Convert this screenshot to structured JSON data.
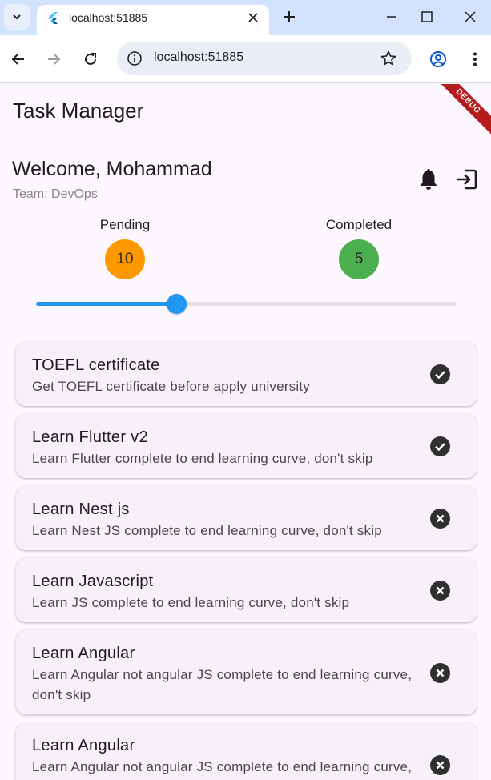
{
  "browser": {
    "tab_title": "localhost:51885",
    "url": "localhost:51885"
  },
  "app": {
    "title": "Task Manager",
    "debug_label": "DEBUG",
    "welcome": "Welcome, Mohammad",
    "team": "Team: DevOps",
    "stats": {
      "pending_label": "Pending",
      "pending_value": "10",
      "pending_color": "#ff9800",
      "completed_label": "Completed",
      "completed_value": "5",
      "completed_color": "#4caf50"
    },
    "progress_slider": {
      "fraction": 0.333
    },
    "tasks": [
      {
        "title": "TOEFL certificate",
        "description": "Get TOEFL certificate before apply university",
        "status": "done"
      },
      {
        "title": "Learn Flutter v2",
        "description": "Learn Flutter complete to end learning curve, don't skip",
        "status": "done"
      },
      {
        "title": "Learn Nest js",
        "description": "Learn Nest JS complete to end learning curve, don't skip",
        "status": "pending"
      },
      {
        "title": "Learn Javascript",
        "description": "Learn JS complete to end learning curve, don't skip",
        "status": "pending"
      },
      {
        "title": "Learn Angular",
        "description": "Learn Angular not angular JS complete to end learning curve, don't skip",
        "status": "pending"
      },
      {
        "title": "Learn Angular",
        "description": "Learn Angular not angular JS complete to end learning curve, don't skip",
        "status": "pending"
      }
    ],
    "accent_color": "#2196f3"
  }
}
